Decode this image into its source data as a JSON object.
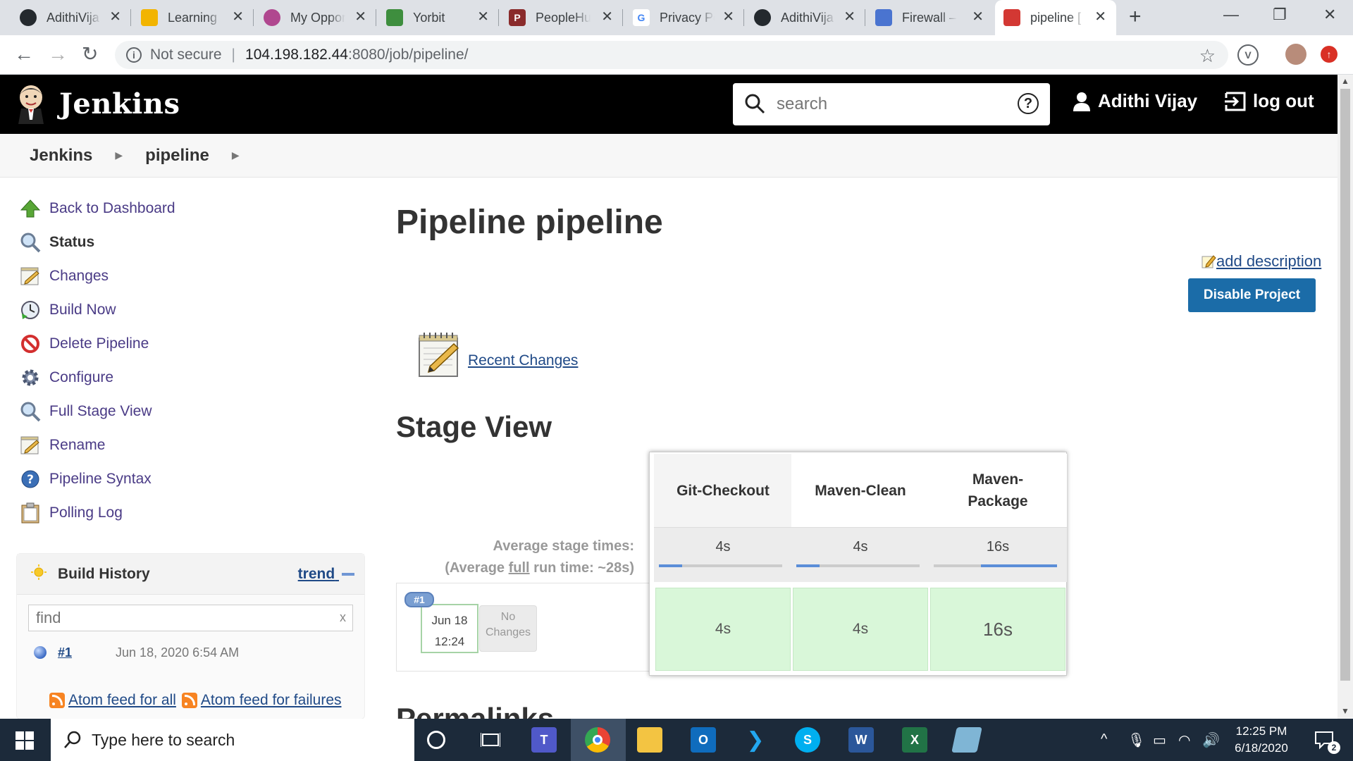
{
  "browser": {
    "tabs": [
      {
        "label": "AdithiVija",
        "icon": "github-icon",
        "color": "#24292e"
      },
      {
        "label": "Learning",
        "icon": "chart-icon",
        "color": "#f2b400"
      },
      {
        "label": "My Oppor",
        "icon": "orb-icon",
        "color": "#b0478f"
      },
      {
        "label": "Yorbit",
        "icon": "cube-icon",
        "color": "#3e8e3e"
      },
      {
        "label": "PeopleHu",
        "icon": "p-icon",
        "color": "#8a2b2b"
      },
      {
        "label": "Privacy Po",
        "icon": "google-icon",
        "color": "#4285f4"
      },
      {
        "label": "AdithiVija",
        "icon": "github-icon",
        "color": "#24292e"
      },
      {
        "label": "Firewall –",
        "icon": "firewall-icon",
        "color": "#4a74d0"
      },
      {
        "label": "pipeline [",
        "icon": "jenkins-icon",
        "color": "#d33833"
      }
    ],
    "address": {
      "security": "Not secure",
      "host": "104.198.182.44",
      "path": ":8080/job/pipeline/"
    }
  },
  "header": {
    "title": "Jenkins",
    "search_placeholder": "search",
    "user": "Adithi Vijay",
    "logout": "log out"
  },
  "breadcrumb": {
    "items": [
      "Jenkins",
      "pipeline"
    ]
  },
  "sidebar": {
    "tasks": [
      {
        "label": "Back to Dashboard",
        "icon": "up-arrow-icon"
      },
      {
        "label": "Status",
        "icon": "magnifier-icon"
      },
      {
        "label": "Changes",
        "icon": "notepad-icon"
      },
      {
        "label": "Build Now",
        "icon": "clock-icon"
      },
      {
        "label": "Delete Pipeline",
        "icon": "no-entry-icon"
      },
      {
        "label": "Configure",
        "icon": "gear-icon"
      },
      {
        "label": "Full Stage View",
        "icon": "magnifier-icon"
      },
      {
        "label": "Rename",
        "icon": "notepad-icon"
      },
      {
        "label": "Pipeline Syntax",
        "icon": "help-icon"
      },
      {
        "label": "Polling Log",
        "icon": "clipboard-icon"
      }
    ],
    "build_history": {
      "title": "Build History",
      "trend": "trend",
      "find_placeholder": "find",
      "builds": [
        {
          "number": "#1",
          "date": "Jun 18, 2020 6:54 AM"
        }
      ],
      "feed_all": "Atom feed for all",
      "feed_failures": "Atom feed for failures"
    }
  },
  "main": {
    "title": "Pipeline pipeline",
    "add_description": "add description",
    "disable_button": "Disable Project",
    "recent_changes": "Recent Changes",
    "stage_view_title": "Stage View",
    "permalinks_title": "Permalinks"
  },
  "stage_view": {
    "avg_label": "Average stage times:",
    "avg_full_prefix": "(Average ",
    "avg_full_word": "full",
    "avg_full_suffix": " run time: ~28s)",
    "stages": [
      {
        "name": "Git-Checkout",
        "avg": "4s",
        "avg_fraction": 0.19,
        "cell": "4s"
      },
      {
        "name": "Maven-Clean",
        "avg": "4s",
        "avg_fraction": 0.19,
        "cell": "4s"
      },
      {
        "name": "Maven-Package",
        "avg": "16s",
        "avg_fraction": 0.62,
        "cell": "16s"
      }
    ],
    "run": {
      "badge": "#1",
      "date": "Jun 18",
      "time": "12:24",
      "changes_line1": "No",
      "changes_line2": "Changes"
    }
  },
  "taskbar": {
    "search_placeholder": "Type here to search",
    "time": "12:25 PM",
    "date": "6/18/2020",
    "notifications": "2"
  }
}
